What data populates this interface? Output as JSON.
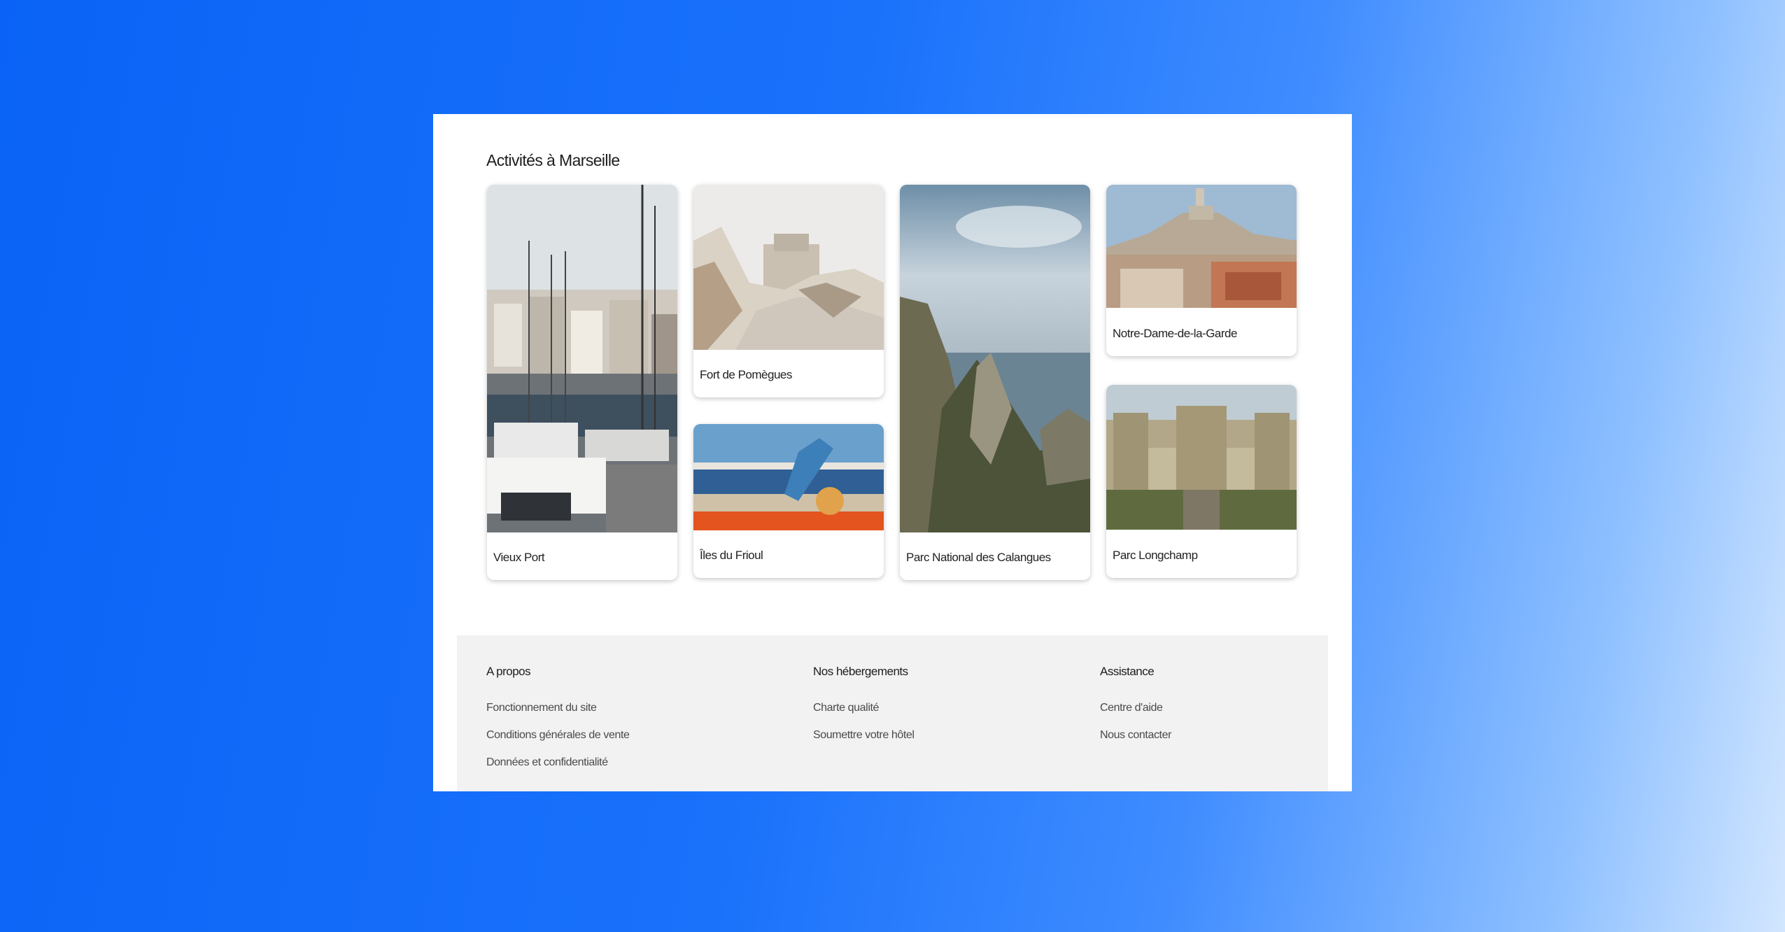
{
  "section": {
    "title": "Activités à Marseille"
  },
  "cards": {
    "vieux_port": "Vieux Port",
    "fort": "Fort de Pomègues",
    "frioul": "Îles du Frioul",
    "calanques": "Parc National des Calangues",
    "notre_dame": "Notre-Dame-de-la-Garde",
    "longchamp": "Parc Longchamp"
  },
  "footer": {
    "columns": [
      {
        "heading": "A propos",
        "links": [
          "Fonctionnement du site",
          "Conditions générales de vente",
          "Données et confidentialité"
        ]
      },
      {
        "heading": "Nos hébergements",
        "links": [
          "Charte qualité",
          "Soumettre votre hôtel"
        ]
      },
      {
        "heading": "Assistance",
        "links": [
          "Centre d'aide",
          "Nous contacter"
        ]
      }
    ]
  },
  "colors": {
    "background_left": "#0a63f6",
    "background_right": "#d2e6ff",
    "footer_bg": "#f2f2f2",
    "page_bg": "#ffffff"
  }
}
